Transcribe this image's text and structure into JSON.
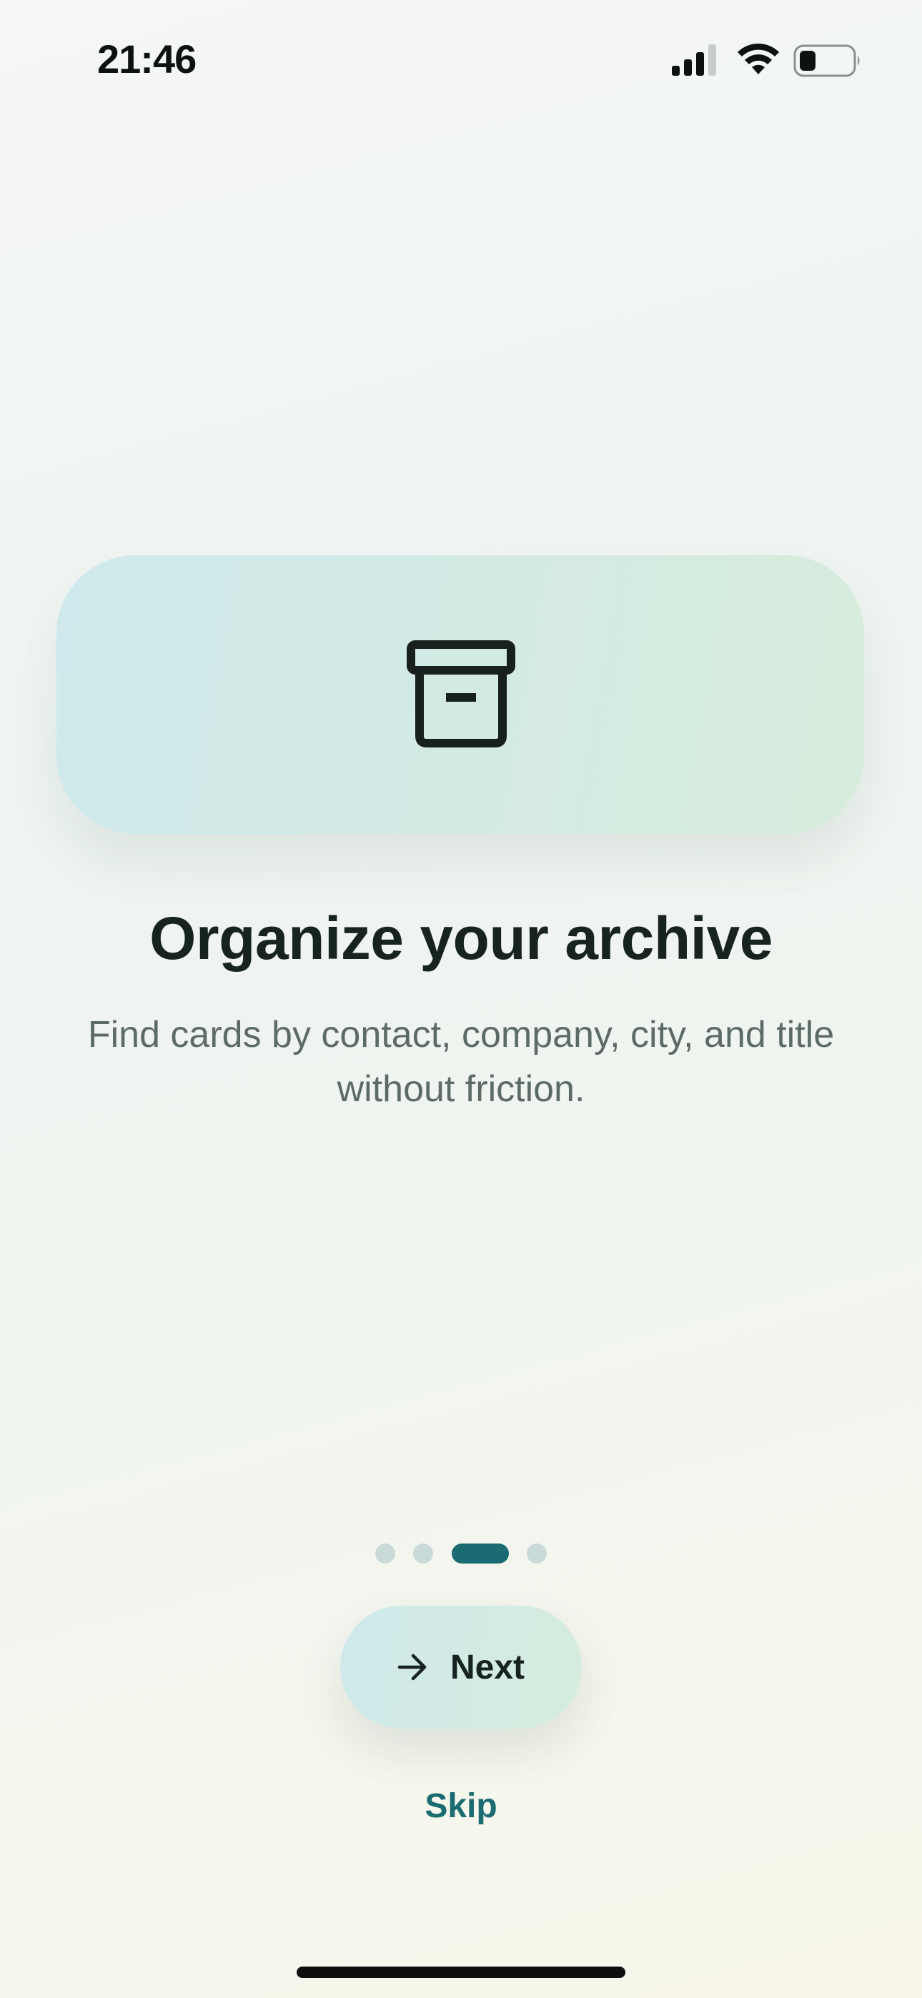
{
  "status_bar": {
    "time": "21:46"
  },
  "onboarding": {
    "icon": "archive-box-icon",
    "title": "Organize your archive",
    "description": "Find cards by contact, company, city, and title without friction.",
    "pager": {
      "total": 4,
      "current": 3
    },
    "next_label": "Next",
    "next_icon": "arrow-right-icon",
    "skip_label": "Skip"
  },
  "colors": {
    "accent": "#1b6b72",
    "text_primary": "#172320",
    "text_secondary": "#5d6b68",
    "dot_inactive": "#cadad8"
  }
}
